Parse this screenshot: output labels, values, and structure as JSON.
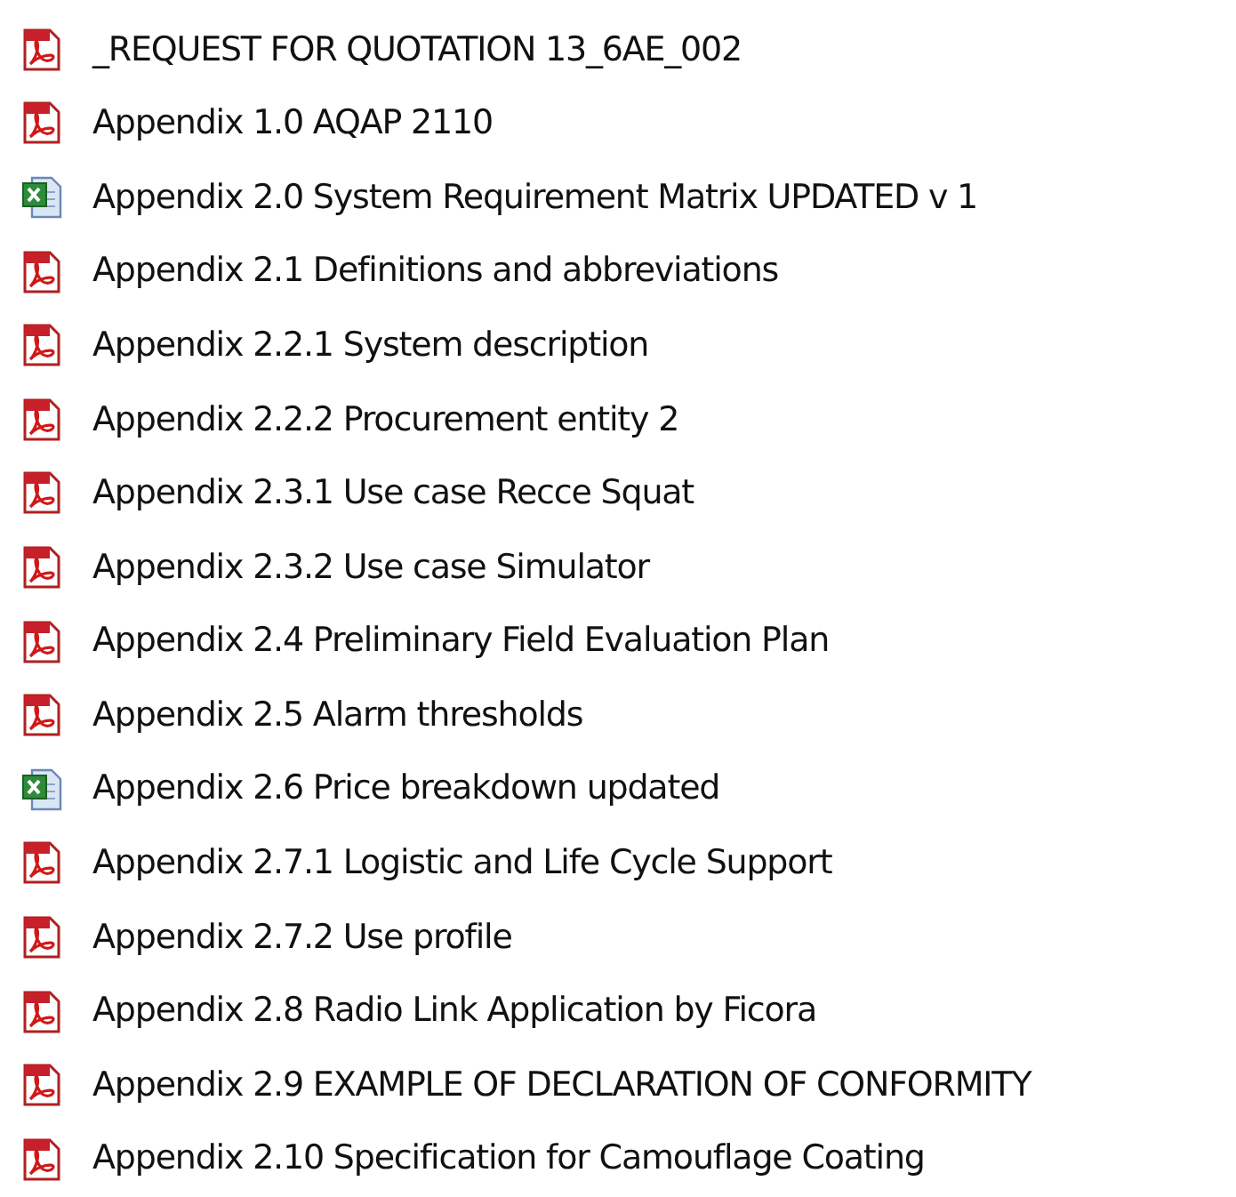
{
  "files": [
    {
      "name": "_REQUEST FOR QUOTATION 13_6AE_002",
      "kind": "pdf"
    },
    {
      "name": "Appendix 1.0 AQAP 2110",
      "kind": "pdf"
    },
    {
      "name": "Appendix 2.0 System Requirement Matrix UPDATED v 1",
      "kind": "excel"
    },
    {
      "name": "Appendix 2.1 Definitions and abbreviations",
      "kind": "pdf"
    },
    {
      "name": "Appendix 2.2.1 System description",
      "kind": "pdf"
    },
    {
      "name": "Appendix 2.2.2 Procurement entity 2",
      "kind": "pdf"
    },
    {
      "name": "Appendix 2.3.1 Use case Recce Squat",
      "kind": "pdf"
    },
    {
      "name": "Appendix 2.3.2 Use case Simulator",
      "kind": "pdf"
    },
    {
      "name": "Appendix 2.4 Preliminary Field Evaluation Plan",
      "kind": "pdf"
    },
    {
      "name": "Appendix 2.5 Alarm thresholds",
      "kind": "pdf"
    },
    {
      "name": "Appendix 2.6 Price breakdown updated",
      "kind": "excel"
    },
    {
      "name": "Appendix 2.7.1 Logistic and Life Cycle Support",
      "kind": "pdf"
    },
    {
      "name": "Appendix 2.7.2 Use profile",
      "kind": "pdf"
    },
    {
      "name": "Appendix 2.8 Radio Link Application by Ficora",
      "kind": "pdf"
    },
    {
      "name": "Appendix 2.9 EXAMPLE OF DECLARATION OF CONFORMITY",
      "kind": "pdf"
    },
    {
      "name": "Appendix 2.10 Specification for Camouflage Coating",
      "kind": "pdf"
    }
  ]
}
